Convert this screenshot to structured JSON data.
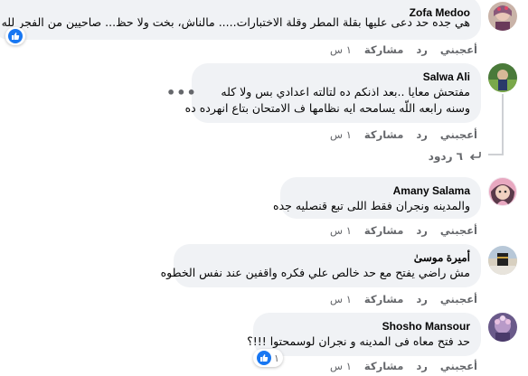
{
  "actions": {
    "like": "أعجبني",
    "reply": "رد",
    "share": "مشاركة"
  },
  "comments": [
    {
      "author": "Zofa Medoo",
      "lines": [
        "هي جده حد دعى عليها بقلة المطر وقلة الاختبارات..... مالناش، بخت ولا حظ... صاحيين من الفجر لله الامر"
      ],
      "time": "",
      "reactions": ""
    },
    {
      "author": "Salwa Ali",
      "lines": [
        "مفتحش معايا ..بعد اذنكم ده لتالته اعدادي بس ولا كله",
        "وسنه رابعه اللّه يسامحه ايه نظامها ف الامتحان بتاع انهرده ده"
      ],
      "time": "١ س",
      "replies_label": "٦ ردود"
    },
    {
      "author": "Amany Salama",
      "lines": [
        "والمدينه ونجران فقط اللى تبع قنصليه جده"
      ],
      "time": "١ س"
    },
    {
      "author": "أميرة موسىٰ",
      "lines": [
        "مش راضي يفتح مع حد خالص علي فكره واقفين عند نفس الخطوه"
      ],
      "time": "١ س"
    },
    {
      "author": "Shosho Mansour",
      "lines": [
        "حد فتح معاه فى المدينه و نجران لوسمحتوا !!!؟"
      ],
      "time": "١ س",
      "reactions": "١"
    }
  ]
}
